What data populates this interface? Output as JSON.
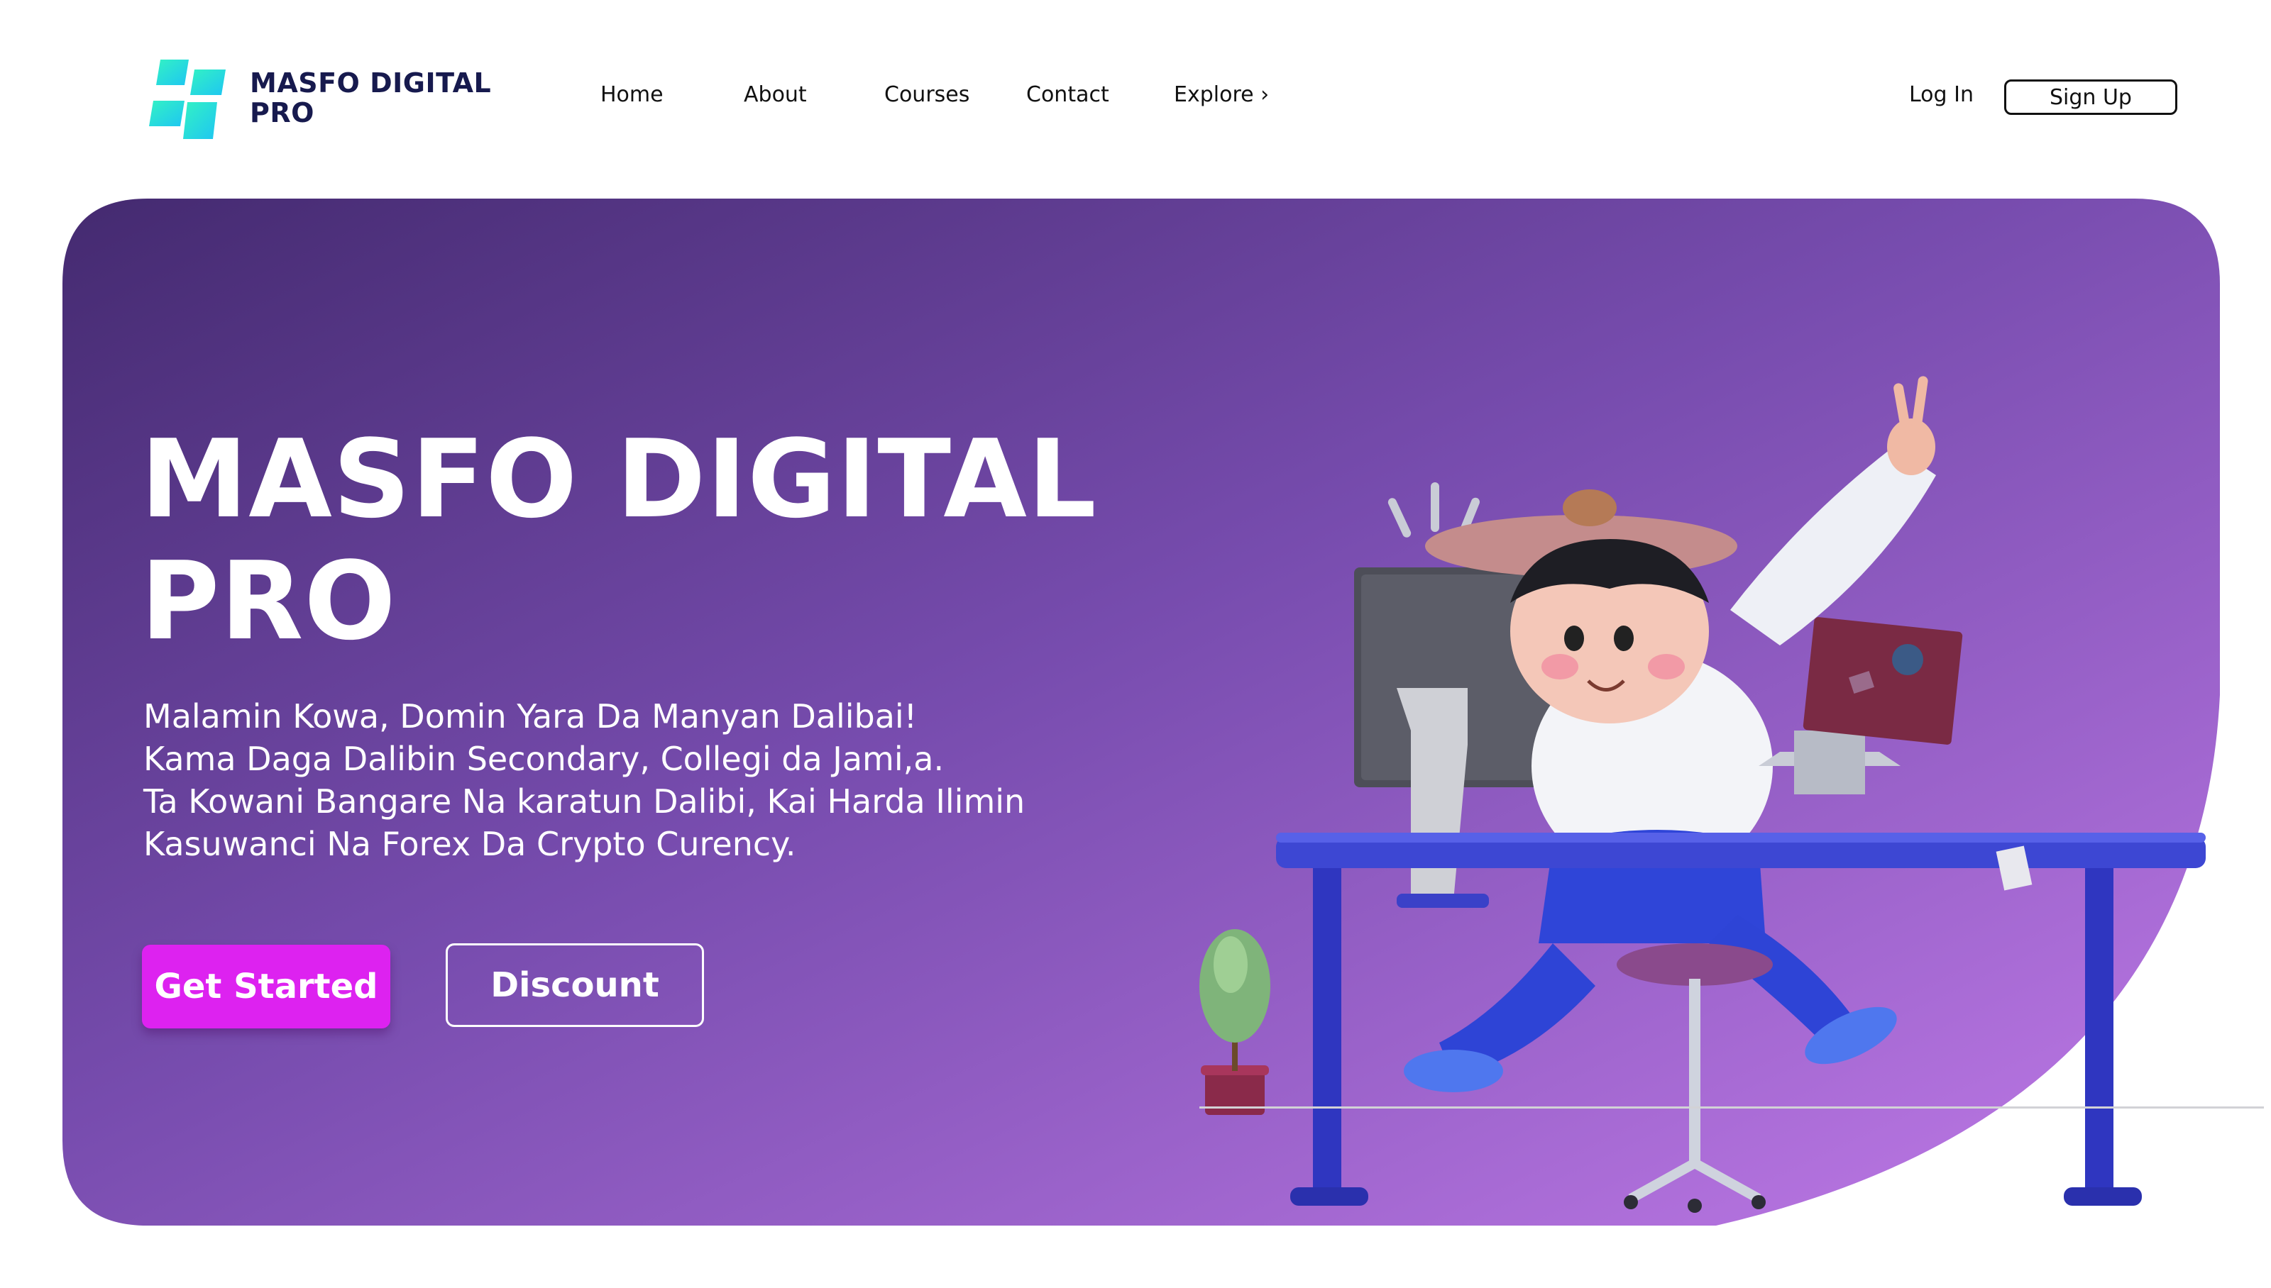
{
  "brand": {
    "line1": "MASFO DIGITAL",
    "line2": "PRO"
  },
  "nav": {
    "items": [
      "Home",
      "About",
      "Courses",
      "Contact",
      "Explore ›"
    ],
    "login": "Log In",
    "signup": "Sign Up"
  },
  "hero": {
    "title_line1": "MASFO DIGITAL",
    "title_line2": "PRO",
    "lines": [
      "Malamin Kowa, Domin Yara Da Manyan Dalibai!",
      "Kama Daga Dalibin Secondary, Collegi da Jami,a.",
      "Ta Kowani Bangare Na karatun Dalibi, Kai Harda Ilimin",
      "Kasuwanci Na Forex Da Crypto Curency."
    ],
    "cta_primary": "Get Started",
    "cta_secondary": "Discount"
  },
  "colors": {
    "brand_text": "#171a4e",
    "logo_gradient": [
      "#2ef0c8",
      "#21c8f0"
    ],
    "hero_gradient": [
      "#452c73",
      "#7d4fb6",
      "#b573e6"
    ],
    "cta_primary": "#dd22f0"
  },
  "icons": [
    "logo-mark-icon",
    "chevron-right-icon"
  ]
}
